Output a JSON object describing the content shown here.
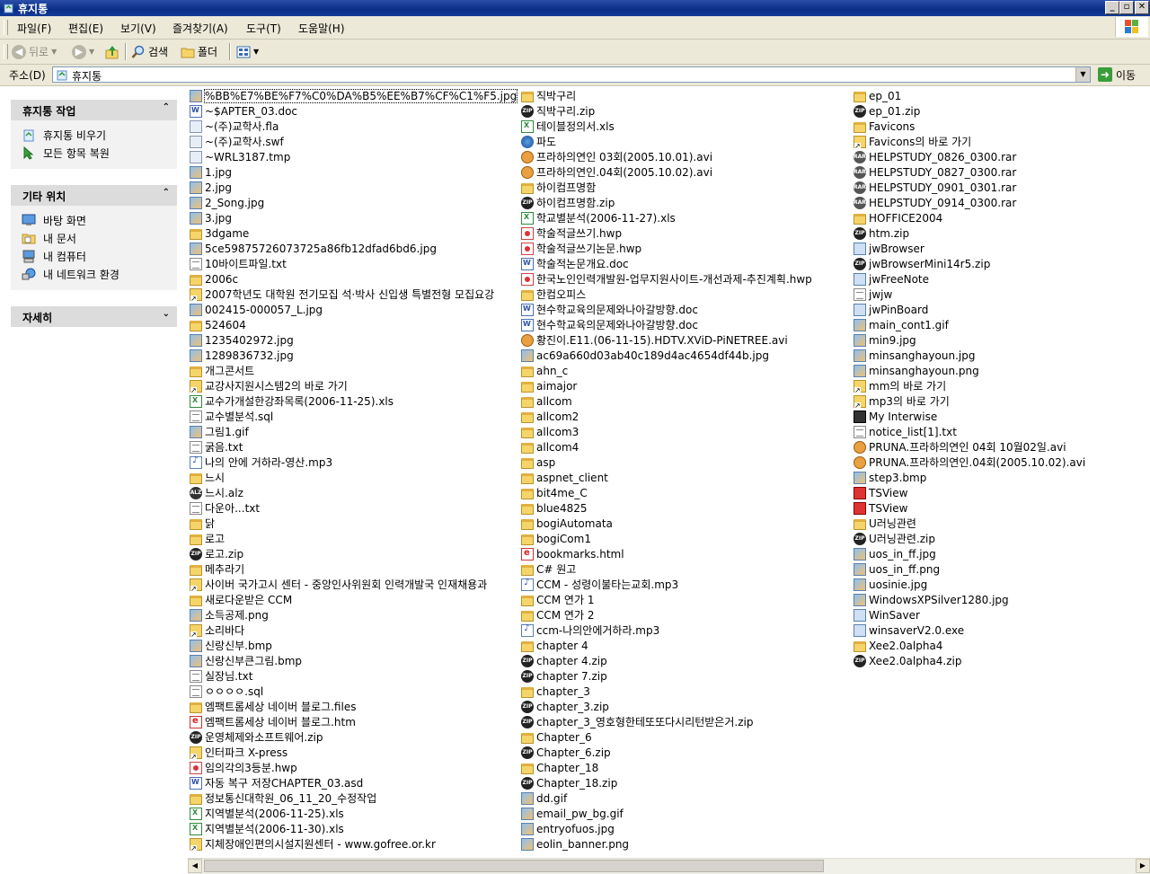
{
  "window": {
    "title": "휴지통",
    "buttons": [
      "_",
      "▫",
      "✕"
    ]
  },
  "menu": [
    "파일(F)",
    "편집(E)",
    "보기(V)",
    "즐겨찾기(A)",
    "도구(T)",
    "도움말(H)"
  ],
  "toolbar": {
    "back": "뒤로",
    "search": "검색",
    "folders": "폴더"
  },
  "address": {
    "label": "주소(D)",
    "value": "휴지통",
    "go": "이동"
  },
  "taskpane": {
    "recycle_tasks": {
      "title": "휴지통 작업",
      "items": [
        {
          "label": "휴지통 비우기",
          "icon": "empty-bin-icon"
        },
        {
          "label": "모든 항목 복원",
          "icon": "restore-icon"
        }
      ]
    },
    "other_places": {
      "title": "기타 위치",
      "items": [
        {
          "label": "바탕 화면",
          "icon": "desktop-icon"
        },
        {
          "label": "내 문서",
          "icon": "my-documents-icon"
        },
        {
          "label": "내 컴퓨터",
          "icon": "my-computer-icon"
        },
        {
          "label": "내 네트워크 환경",
          "icon": "network-icon"
        }
      ]
    },
    "details": {
      "title": "자세히"
    }
  },
  "files": {
    "col1": [
      {
        "name": "%BB%E7%BE%F7%C0%DA%B5%EE%B7%CF%C1%F5.jpg",
        "type": "img"
      },
      {
        "name": "~$APTER_03.doc",
        "type": "doc"
      },
      {
        "name": "~(주)교학사.fla",
        "type": "gen"
      },
      {
        "name": "~(주)교학사.swf",
        "type": "gen"
      },
      {
        "name": "~WRL3187.tmp",
        "type": "gen"
      },
      {
        "name": "1.jpg",
        "type": "img"
      },
      {
        "name": "2.jpg",
        "type": "img"
      },
      {
        "name": "2_Song.jpg",
        "type": "img"
      },
      {
        "name": "3.jpg",
        "type": "img"
      },
      {
        "name": "3dgame",
        "type": "folder"
      },
      {
        "name": "5ce59875726073725a86fb12dfad6bd6.jpg",
        "type": "img"
      },
      {
        "name": "10바이트파일.txt",
        "type": "txt"
      },
      {
        "name": "2006c",
        "type": "folder"
      },
      {
        "name": "2007학년도 대학원 전기모집 석·박사 신입생 특별전형 모집요강",
        "type": "shortcut"
      },
      {
        "name": "002415-000057_L.jpg",
        "type": "img"
      },
      {
        "name": "524604",
        "type": "folder"
      },
      {
        "name": "1235402972.jpg",
        "type": "img"
      },
      {
        "name": "1289836732.jpg",
        "type": "img"
      },
      {
        "name": "개그콘서트",
        "type": "folder"
      },
      {
        "name": "교강사지원시스템2의 바로 가기",
        "type": "shortcut"
      },
      {
        "name": "교수가개설한강좌목록(2006-11-25).xls",
        "type": "xls"
      },
      {
        "name": "교수별분석.sql",
        "type": "txt"
      },
      {
        "name": "그림1.gif",
        "type": "img"
      },
      {
        "name": "굵음.txt",
        "type": "txt"
      },
      {
        "name": "나의 안에 거하라-영산.mp3",
        "type": "mp3"
      },
      {
        "name": "느시",
        "type": "folder"
      },
      {
        "name": "느시.alz",
        "type": "alz"
      },
      {
        "name": "다운아...txt",
        "type": "txt"
      },
      {
        "name": "닭",
        "type": "folder"
      },
      {
        "name": "로고",
        "type": "folder"
      },
      {
        "name": "로고.zip",
        "type": "zip"
      },
      {
        "name": "메추라기",
        "type": "folder"
      },
      {
        "name": "사이버 국가고시 센터 - 중앙인사위원회 인력개발국 인재채용과",
        "type": "shortcut"
      },
      {
        "name": "새로다운받은 CCM",
        "type": "folder"
      },
      {
        "name": "소득공제.png",
        "type": "img"
      },
      {
        "name": "소리바다",
        "type": "shortcut"
      },
      {
        "name": "신랑신부.bmp",
        "type": "img"
      },
      {
        "name": "신랑신부큰그림.bmp",
        "type": "img"
      },
      {
        "name": "실장님.txt",
        "type": "txt"
      },
      {
        "name": "ㅇㅇㅇㅇ.sql",
        "type": "txt"
      },
      {
        "name": "엠팩트롬세상  네이버 블로그.files",
        "type": "folder"
      },
      {
        "name": "엠팩트롬세상  네이버 블로그.htm",
        "type": "html"
      },
      {
        "name": "운영체제와소프트웨어.zip",
        "type": "zip"
      },
      {
        "name": "인터파크 X-press",
        "type": "shortcut"
      },
      {
        "name": "임의각의3등분.hwp",
        "type": "hwp"
      },
      {
        "name": "자동 복구 저장CHAPTER_03.asd",
        "type": "doc"
      },
      {
        "name": "정보통신대학원_06_11_20_수정작업",
        "type": "folder"
      },
      {
        "name": "지역별분석(2006-11-25).xls",
        "type": "xls"
      },
      {
        "name": "지역별분석(2006-11-30).xls",
        "type": "xls"
      },
      {
        "name": "지체장애인편의시설지원센터 - www.gofree.or.kr",
        "type": "shortcut"
      }
    ],
    "col2": [
      {
        "name": "직박구리",
        "type": "folder"
      },
      {
        "name": "직박구리.zip",
        "type": "zip"
      },
      {
        "name": "테이블정의서.xls",
        "type": "xls"
      },
      {
        "name": "파도",
        "type": "globe"
      },
      {
        "name": "프라하의연인 03회(2005.10.01).avi",
        "type": "avi"
      },
      {
        "name": "프라하의연인.04회(2005.10.02).avi",
        "type": "avi"
      },
      {
        "name": "하이컴프명함",
        "type": "folder"
      },
      {
        "name": "하이컴프명함.zip",
        "type": "zip"
      },
      {
        "name": "학교별분석(2006-11-27).xls",
        "type": "xls"
      },
      {
        "name": "학술적글쓰기.hwp",
        "type": "hwp"
      },
      {
        "name": "학술적글쓰기논문.hwp",
        "type": "hwp"
      },
      {
        "name": "학술적논문개요.doc",
        "type": "doc"
      },
      {
        "name": "한국노인인력개발원-업무지원사이트-개선과제-추진계획.hwp",
        "type": "hwp"
      },
      {
        "name": "한컴오피스",
        "type": "folder"
      },
      {
        "name": "현수학교육의문제와나아갈방향.doc",
        "type": "doc"
      },
      {
        "name": "현수학교육의문제와나아갈방향.doc",
        "type": "doc"
      },
      {
        "name": "황진이.E11.(06-11-15).HDTV.XViD-PiNETREE.avi",
        "type": "avi"
      },
      {
        "name": "ac69a660d03ab40c189d4ac4654df44b.jpg",
        "type": "img"
      },
      {
        "name": "ahn_c",
        "type": "folder"
      },
      {
        "name": "aimajor",
        "type": "folder"
      },
      {
        "name": "allcom",
        "type": "folder"
      },
      {
        "name": "allcom2",
        "type": "folder"
      },
      {
        "name": "allcom3",
        "type": "folder"
      },
      {
        "name": "allcom4",
        "type": "folder"
      },
      {
        "name": "asp",
        "type": "folder"
      },
      {
        "name": "aspnet_client",
        "type": "folder"
      },
      {
        "name": "bit4me_C",
        "type": "folder"
      },
      {
        "name": "blue4825",
        "type": "folder"
      },
      {
        "name": "bogiAutomata",
        "type": "folder"
      },
      {
        "name": "bogiCom1",
        "type": "folder"
      },
      {
        "name": "bookmarks.html",
        "type": "html"
      },
      {
        "name": "C# 원고",
        "type": "folder"
      },
      {
        "name": "CCM - 성령이불타는교회.mp3",
        "type": "mp3"
      },
      {
        "name": "CCM 연가 1",
        "type": "folder"
      },
      {
        "name": "CCM 연가 2",
        "type": "folder"
      },
      {
        "name": "ccm-나의안에거하라.mp3",
        "type": "mp3"
      },
      {
        "name": "chapter 4",
        "type": "folder"
      },
      {
        "name": "chapter 4.zip",
        "type": "zip"
      },
      {
        "name": "chapter 7.zip",
        "type": "zip"
      },
      {
        "name": "chapter_3",
        "type": "folder"
      },
      {
        "name": "chapter_3.zip",
        "type": "zip"
      },
      {
        "name": "chapter_3_영호형한테또또다시리턴받은거.zip",
        "type": "zip"
      },
      {
        "name": "Chapter_6",
        "type": "folder"
      },
      {
        "name": "Chapter_6.zip",
        "type": "zip"
      },
      {
        "name": "Chapter_18",
        "type": "folder"
      },
      {
        "name": "Chapter_18.zip",
        "type": "zip"
      },
      {
        "name": "dd.gif",
        "type": "img"
      },
      {
        "name": "email_pw_bg.gif",
        "type": "img"
      },
      {
        "name": "entryofuos.jpg",
        "type": "img"
      },
      {
        "name": "eolin_banner.png",
        "type": "img"
      }
    ],
    "col3": [
      {
        "name": "ep_01",
        "type": "folder"
      },
      {
        "name": "ep_01.zip",
        "type": "zip"
      },
      {
        "name": "Favicons",
        "type": "folder"
      },
      {
        "name": "Favicons의 바로 가기",
        "type": "shortcut"
      },
      {
        "name": "HELPSTUDY_0826_0300.rar",
        "type": "rar"
      },
      {
        "name": "HELPSTUDY_0827_0300.rar",
        "type": "rar"
      },
      {
        "name": "HELPSTUDY_0901_0301.rar",
        "type": "rar"
      },
      {
        "name": "HELPSTUDY_0914_0300.rar",
        "type": "rar"
      },
      {
        "name": "HOFFICE2004",
        "type": "folder"
      },
      {
        "name": "htm.zip",
        "type": "zip"
      },
      {
        "name": "jwBrowser",
        "type": "exe"
      },
      {
        "name": "jwBrowserMini14r5.zip",
        "type": "zip"
      },
      {
        "name": "jwFreeNote",
        "type": "exe"
      },
      {
        "name": "jwjw",
        "type": "txt"
      },
      {
        "name": "jwPinBoard",
        "type": "exe"
      },
      {
        "name": "main_cont1.gif",
        "type": "img"
      },
      {
        "name": "min9.jpg",
        "type": "img"
      },
      {
        "name": "minsanghayoun.jpg",
        "type": "img"
      },
      {
        "name": "minsanghayoun.png",
        "type": "img"
      },
      {
        "name": "mm의 바로 가기",
        "type": "shortcut"
      },
      {
        "name": "mp3의 바로 가기",
        "type": "shortcut"
      },
      {
        "name": "My Interwise",
        "type": "black"
      },
      {
        "name": "notice_list[1].txt",
        "type": "txt"
      },
      {
        "name": "PRUNA.프라하의연인 04회 10월02일.avi",
        "type": "avi"
      },
      {
        "name": "PRUNA.프라하의연인.04회(2005.10.02).avi",
        "type": "avi"
      },
      {
        "name": "step3.bmp",
        "type": "img"
      },
      {
        "name": "TSView",
        "type": "red"
      },
      {
        "name": "TSView",
        "type": "red"
      },
      {
        "name": "U러닝관련",
        "type": "folder"
      },
      {
        "name": "U러닝관련.zip",
        "type": "zip"
      },
      {
        "name": "uos_in_ff.jpg",
        "type": "img"
      },
      {
        "name": "uos_in_ff.png",
        "type": "img"
      },
      {
        "name": "uosinie.jpg",
        "type": "img"
      },
      {
        "name": "WindowsXPSilver1280.jpg",
        "type": "img"
      },
      {
        "name": "WinSaver",
        "type": "exe"
      },
      {
        "name": "winsaverV2.0.exe",
        "type": "exe"
      },
      {
        "name": "Xee2.0alpha4",
        "type": "folder"
      },
      {
        "name": "Xee2.0alpha4.zip",
        "type": "zip"
      }
    ]
  }
}
